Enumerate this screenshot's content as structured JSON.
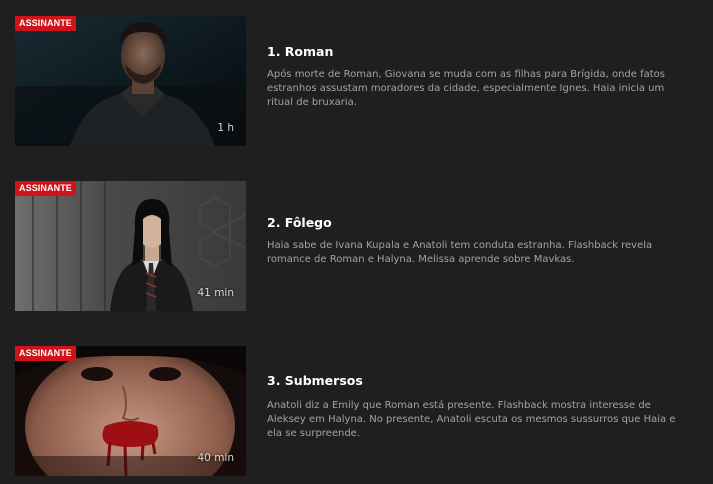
{
  "episodes": [
    {
      "badge": "ASSINANTE",
      "duration": "1 h",
      "title": "1. Roman",
      "description": "Após morte de Roman, Giovana se muda com as filhas para Brígida, onde fatos estranhos assustam moradores da cidade, especialmente Ignes. Haia inicia um ritual de bruxaria."
    },
    {
      "badge": "ASSINANTE",
      "duration": "41 min",
      "title": "2. Fôlego",
      "description": "Haia sabe de Ivana Kupala e Anatoli tem conduta estranha. Flashback revela romance de Roman e Halyna. Melissa aprende sobre Mavkas."
    },
    {
      "badge": "ASSINANTE",
      "duration": "40 min",
      "title": "3. Submersos",
      "description": "Anatoli diz a Emily que Roman está presente. Flashback mostra interesse de Aleksey em Halyna. No presente, Anatoli escuta os mesmos sussurros que Haia e ela se surpreende."
    }
  ],
  "colors": {
    "background": "#1f1f1f",
    "badge": "#d0121a",
    "title": "#ffffff",
    "description": "#a3a3a3"
  }
}
